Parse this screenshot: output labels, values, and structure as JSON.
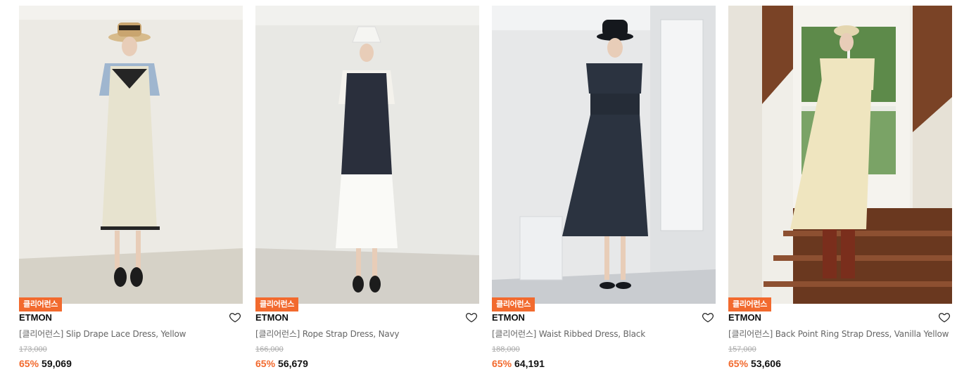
{
  "products": [
    {
      "badge": "클리어런스",
      "brand": "ETMON",
      "name": "[클리어런스] Slip Drape Lace Dress, Yellow",
      "original_price": "173,000",
      "discount": "65%",
      "price": "59,069",
      "colors": {
        "wall": "#eceae4",
        "floor": "#d6d2c7",
        "dress": "#e7e3cf",
        "top": "#9fb6cf",
        "hat": "#d7bb8c",
        "shoes": "#1c1c1c"
      }
    },
    {
      "badge": "클리어런스",
      "brand": "ETMON",
      "name": "[클리어런스] Rope Strap Dress, Navy",
      "original_price": "166,000",
      "discount": "65%",
      "price": "56,679",
      "colors": {
        "wall": "#e8e8e4",
        "floor": "#d3d0c9",
        "dress": "#2a2f3c",
        "top": "#f4f2ec",
        "hat": "#f5f5f2",
        "shoes": "#1c1c1c"
      }
    },
    {
      "badge": "클리어런스",
      "brand": "ETMON",
      "name": "[클리어런스] Waist Ribbed Dress, Black",
      "original_price": "188,000",
      "discount": "65%",
      "price": "64,191",
      "colors": {
        "wall": "#e7e8e9",
        "floor": "#c9ccd0",
        "dress": "#2b3340",
        "top": "#2b3340",
        "hat": "#15181d",
        "shoes": "#15181d"
      }
    },
    {
      "badge": "클리어런스",
      "brand": "ETMON",
      "name": "[클리어런스] Back Point Ring Strap Dress, Vanilla Yellow",
      "original_price": "157,000",
      "discount": "65%",
      "price": "53,606",
      "colors": {
        "wall": "#f0eee8",
        "floor": "#7a4326",
        "dress": "#efe5bf",
        "top": "#efe5bf",
        "hat": "#e4d6b0",
        "shoes": "#7a2e1c"
      }
    }
  ],
  "accent_color": "#f26a2e"
}
